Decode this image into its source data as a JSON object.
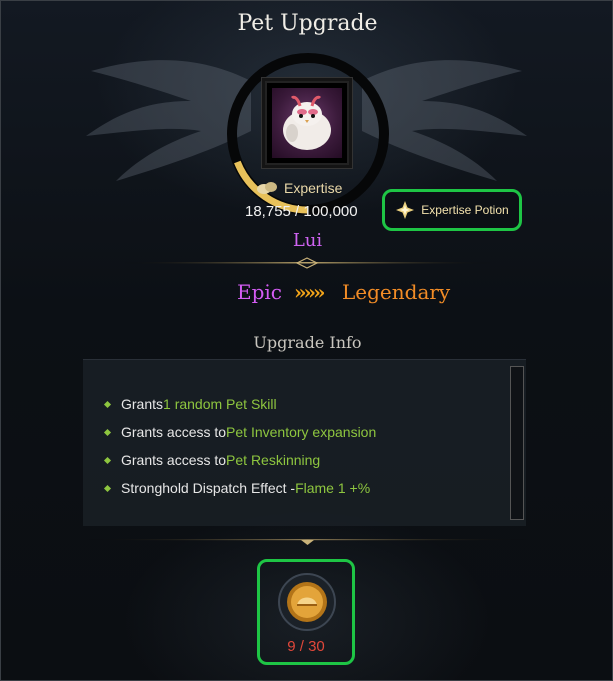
{
  "window": {
    "title": "Pet Upgrade"
  },
  "pet": {
    "name": "Lui",
    "portrait_icon": "pet-bird-portrait"
  },
  "expertise": {
    "label": "Expertise",
    "value": "18,755 / 100,000",
    "fill_fraction": 0.19,
    "icon": "expertise-icon"
  },
  "potion_button": {
    "label": "Expertise Potion",
    "icon": "potion-sparkle-icon"
  },
  "grade": {
    "from": "Epic",
    "arrow": "»»»",
    "to": "Legendary",
    "from_color": "#d35cf3",
    "to_color": "#f28c26"
  },
  "upgrade_info": {
    "title": "Upgrade Info",
    "items": [
      {
        "text": "Grants ",
        "highlight": "1 random Pet Skill"
      },
      {
        "text": "Grants access to ",
        "highlight": "Pet Inventory expansion"
      },
      {
        "text": "Grants access to ",
        "highlight": "Pet Reskinning"
      },
      {
        "text": "Stronghold Dispatch Effect - ",
        "highlight": "Flame 1 +%"
      }
    ]
  },
  "material": {
    "count": "9 / 30",
    "icon": "gold-medal-icon"
  },
  "colors": {
    "accent_green": "#8ec63f",
    "highlight_border": "#1ec545",
    "gold": "#e8c15a"
  }
}
